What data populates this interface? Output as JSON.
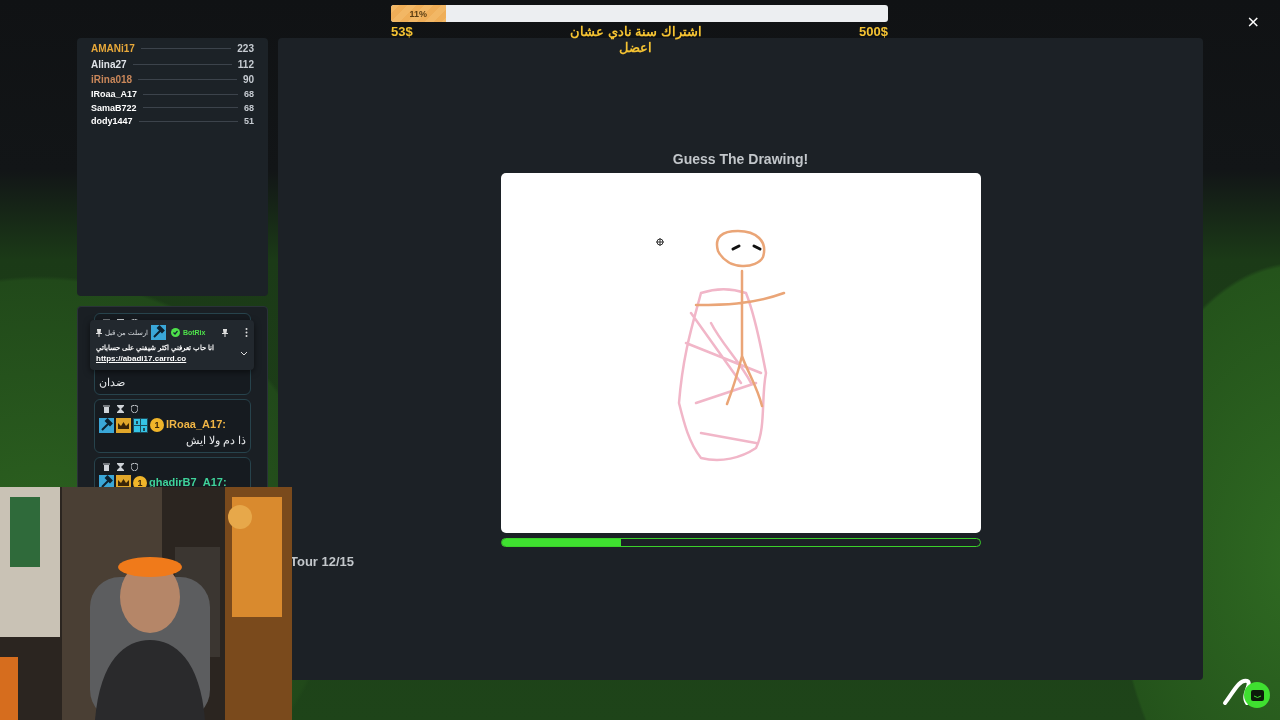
{
  "goal": {
    "percent": "11%",
    "level": 0.11,
    "current": "53$",
    "title": "اشتراك سنة نادي عشان اعضل",
    "target": "500$"
  },
  "close": "×",
  "leaderboard": [
    {
      "name": "AMANi17",
      "score": "223",
      "color": "#e8a93a"
    },
    {
      "name": "Alina27",
      "score": "112",
      "color": "#dfe3e8"
    },
    {
      "name": "iRina018",
      "score": "90",
      "color": "#c9875a"
    },
    {
      "name": "IRoaa_A17",
      "score": "68",
      "color": "#ffffff"
    },
    {
      "name": "SamaB722",
      "score": "68",
      "color": "#ffffff"
    },
    {
      "name": "dody1447",
      "score": "51",
      "color": "#ffffff"
    }
  ],
  "chat": [
    {
      "text": "ضدان"
    },
    {
      "user": "IRoaa_A17:",
      "color": "#f0b545",
      "badges": [
        {
          "kind": "hammer"
        },
        {
          "kind": "crown"
        },
        {
          "kind": "tile"
        },
        {
          "kind": "rank",
          "text": "1"
        }
      ],
      "text": "ذا دم ولا ايش"
    },
    {
      "user": "ghadirB7_A17:",
      "color": "#3fd39a",
      "badges": [
        {
          "kind": "hammer"
        },
        {
          "kind": "crown"
        },
        {
          "kind": "rank",
          "text": "1"
        }
      ]
    }
  ],
  "pinned": {
    "label": "ارسلت من قبل",
    "sender": "BotRix",
    "message": "انا حاب تعرفني اكثر شيفني على حساباتي",
    "link": "https://abadi17.carrd.co"
  },
  "game": {
    "title": "Guess The Drawing!",
    "level": 0.25,
    "round": "Tour 12/15"
  }
}
